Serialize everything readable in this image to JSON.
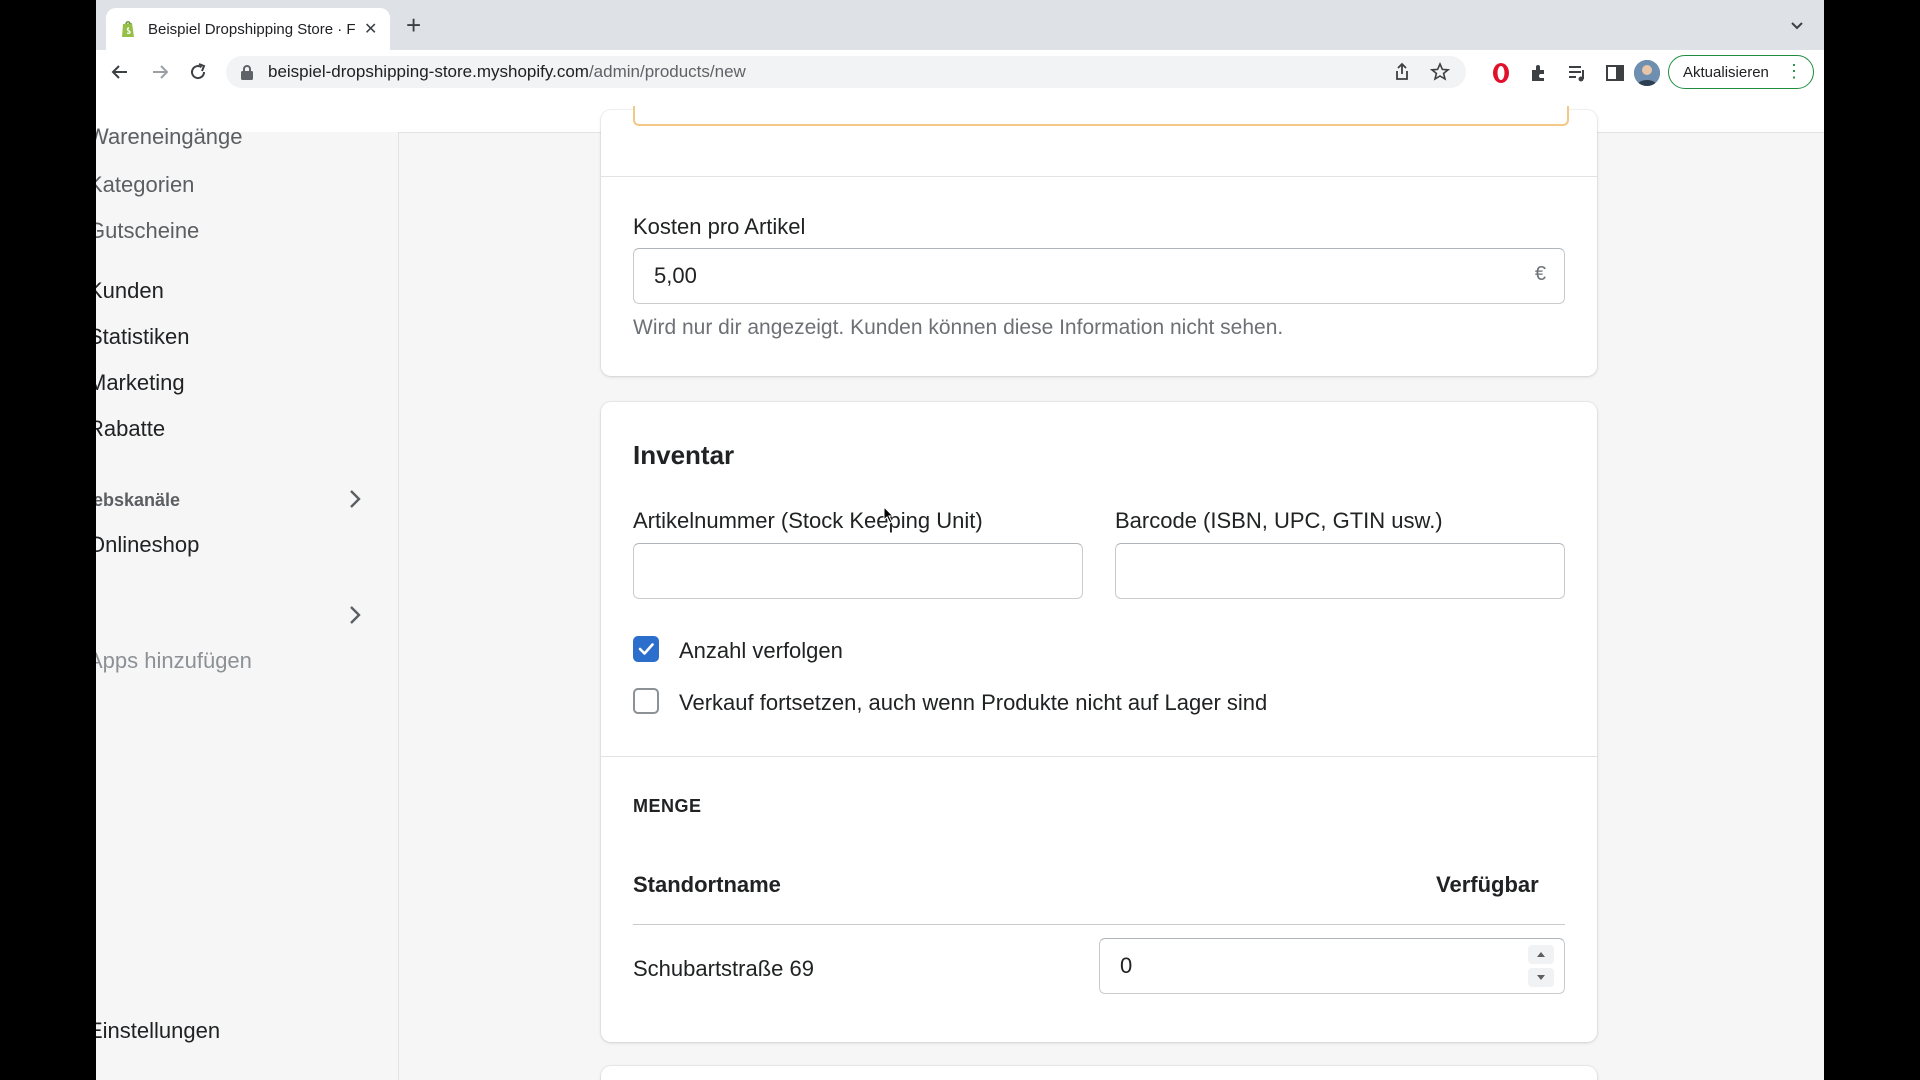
{
  "browser": {
    "tab_title": "Beispiel Dropshipping Store · F",
    "url_host": "beispiel-dropshipping-store.myshopify.com",
    "url_path": "/admin/products/new",
    "update_label": "Aktualisieren"
  },
  "sidebar": {
    "items": [
      {
        "label": "Wareneingänge"
      },
      {
        "label": "Kategorien"
      },
      {
        "label": "Gutscheine"
      },
      {
        "label": "Kunden"
      },
      {
        "label": "Statistiken"
      },
      {
        "label": "Marketing"
      },
      {
        "label": "Rabatte"
      }
    ],
    "sales_channels_heading": "iebskanäle",
    "online_store": "Onlineshop",
    "add_apps": "Apps hinzufügen",
    "settings": "Einstellungen"
  },
  "cost_card": {
    "label": "Kosten pro Artikel",
    "value": "5,00",
    "currency": "€",
    "help": "Wird nur dir angezeigt. Kunden können diese Information nicht sehen."
  },
  "inventory": {
    "title": "Inventar",
    "sku_label": "Artikelnummer (Stock Keeping Unit)",
    "sku_value": "",
    "barcode_label": "Barcode (ISBN, UPC, GTIN usw.)",
    "barcode_value": "",
    "track_quantity_label": "Anzahl verfolgen",
    "track_quantity_checked": true,
    "continue_selling_label": "Verkauf fortsetzen, auch wenn Produkte nicht auf Lager sind",
    "continue_selling_checked": false,
    "quantity_heading": "MENGE",
    "col_location": "Standortname",
    "col_available": "Verfügbar",
    "locations": [
      {
        "name": "Schubartstraße 69",
        "available": "0"
      }
    ]
  },
  "colors": {
    "accent": "#2c6ecb",
    "warning_border": "#f3c884",
    "update_green": "#1e8e3e"
  }
}
